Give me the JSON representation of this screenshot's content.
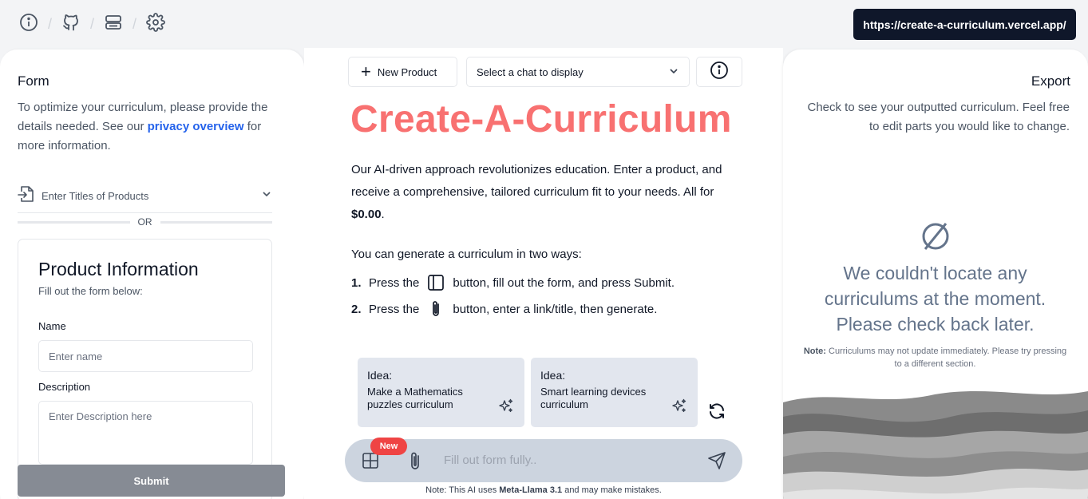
{
  "topbar": {
    "icons": [
      "info-icon",
      "github-icon",
      "server-icon",
      "gear-icon"
    ],
    "url": "https://create-a-curriculum.vercel.app/"
  },
  "left": {
    "title": "Form",
    "intro_before": "To optimize your curriculum, please provide the details needed. See our ",
    "intro_link": "privacy overview",
    "intro_after": " for more information.",
    "titles_label": "Enter Titles of Products",
    "or_label": "OR",
    "product_card": {
      "title": "Product Information",
      "subtitle": "Fill out the form below:",
      "name_label": "Name",
      "name_placeholder": "Enter name",
      "description_label": "Description",
      "description_placeholder": "Enter Description here"
    },
    "submit_label": "Submit"
  },
  "center": {
    "new_product_label": "New Product",
    "chat_select_value": "Select a chat to display",
    "hero_title": "Create-A-Curriculum",
    "intro_text": "Our AI-driven approach revolutionizes education. Enter a product, and receive a comprehensive, tailored curriculum fit to your needs. All for ",
    "intro_price": "$0.00",
    "intro_end": ".",
    "ways_title": "You can generate a curriculum in two ways:",
    "ways": [
      {
        "num": "1.",
        "before": "Press the",
        "icon": "sidebar-panel-icon",
        "after": "button, fill out the form, and press Submit."
      },
      {
        "num": "2.",
        "before": "Press the",
        "icon": "paperclip-icon",
        "after": "button, enter a link/title, then generate."
      }
    ],
    "ideas": [
      {
        "heading": "Idea:",
        "text": "Make a Mathematics puzzles curriculum"
      },
      {
        "heading": "Idea:",
        "text": "Smart learning devices curriculum"
      }
    ],
    "new_badge": "New",
    "chat_placeholder": "Fill out form fully..",
    "note_before": "Note: This AI uses ",
    "note_model": "Meta-Llama 3.1",
    "note_after": " and may make mistakes."
  },
  "right": {
    "title": "Export",
    "intro": "Check to see your outputted curriculum. Feel free to edit parts you would like to change.",
    "empty_title": "We couldn't locate any curriculums at the moment. Please check back later.",
    "note_label": "Note:",
    "note_text": " Curriculums may not update immediately. Please try pressing to a different section."
  },
  "colors": {
    "accent_red": "#f87171",
    "link_blue": "#2563eb",
    "url_pill_bg": "#0f172a",
    "submit_bg": "#868b94",
    "idea_bg": "#e2e6ee",
    "chat_bar_bg": "#ccd4df",
    "badge_red": "#ef4444"
  }
}
